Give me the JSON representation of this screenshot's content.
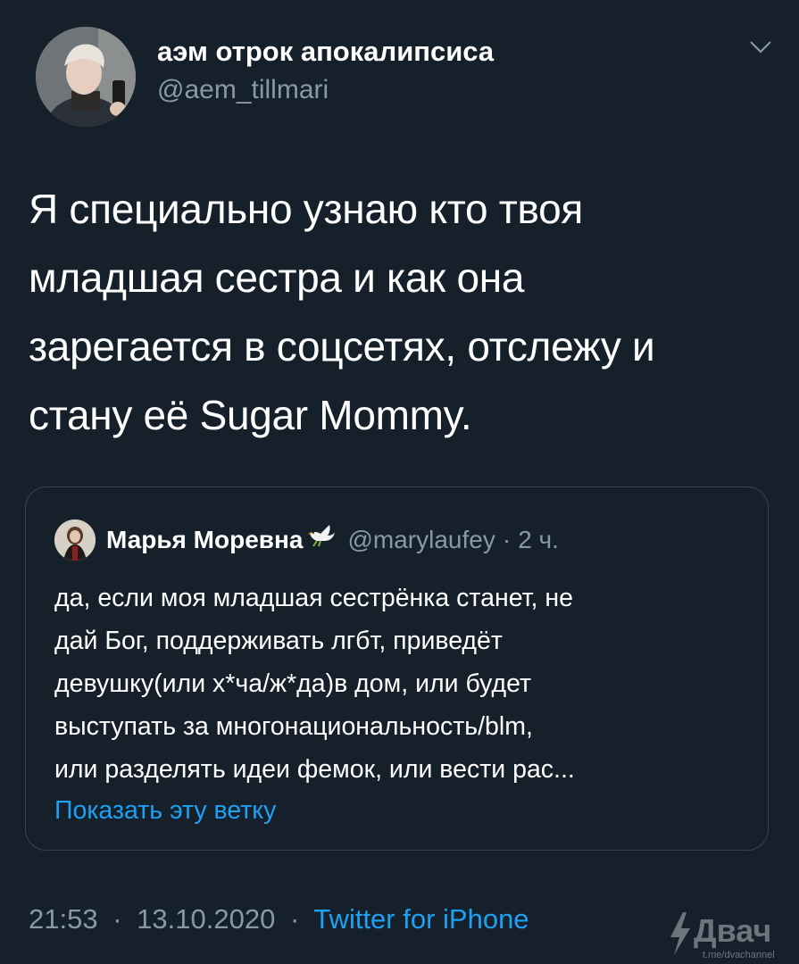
{
  "tweet": {
    "author": {
      "display_name": "аэм отрок апокалипсиса",
      "handle": "@aem_tillmari"
    },
    "text_lines": [
      "Я специально узнаю кто твоя",
      "младшая сестра и как она",
      "зарегается в соцсетях, отслежу и",
      "стану её Sugar Mommy."
    ],
    "time": "21:53",
    "separator": "·",
    "date": "13.10.2020",
    "client": "Twitter for iPhone"
  },
  "quoted": {
    "display_name": "Марья Моревна",
    "handle": "@marylaufey",
    "time": "2 ч.",
    "time_prefix": "·",
    "text_lines": [
      "да, если моя младшая сестрёнка станет, не",
      "дай Бог, поддерживать лгбт, приведёт",
      "девушку(или х*ча/ж*да)в дом, или будет",
      "выступать за многонациональность/blm,",
      "или разделять идеи фемок, или вести рас..."
    ],
    "show_thread": "Показать эту ветку"
  },
  "watermark": {
    "name": "Двач",
    "url": "t.me/dvachannel"
  },
  "colors": {
    "background": "#15202b",
    "muted": "#8899a6",
    "link": "#1da1f2",
    "border": "#38444d"
  },
  "icons": {
    "chevron": "chevron-down-icon",
    "dove": "dove-emoji-icon",
    "watermark_bolt": "lightning-bolt-icon"
  }
}
